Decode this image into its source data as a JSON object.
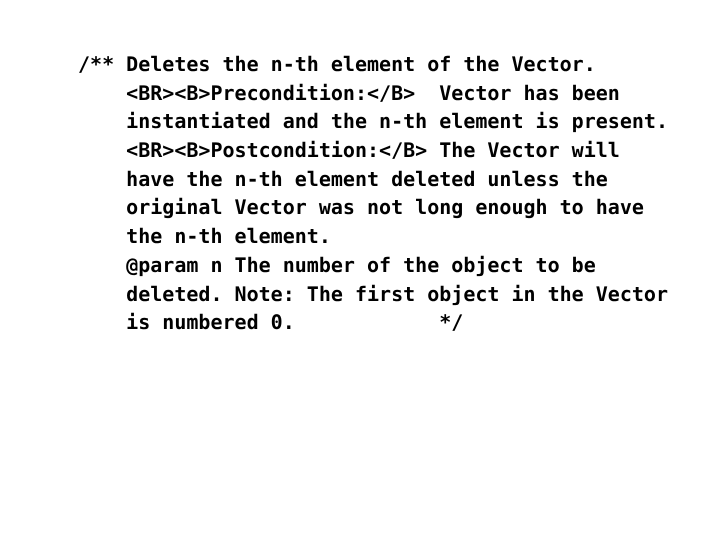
{
  "document": {
    "kind": "javadoc-comment",
    "background_color": "#ffffff",
    "text_color": "#000000",
    "lines": [
      "/** Deletes the n-th element of the Vector.",
      "    <BR><B>Precondition:</B>  Vector has been",
      "    instantiated and the n-th element is present.",
      "    <BR><B>Postcondition:</B> The Vector will",
      "    have the n-th element deleted unless the",
      "    original Vector was not long enough to have",
      "    the n-th element.",
      "    @param n The number of the object to be",
      "    deleted. Note: The first object in the Vector",
      "    is numbered 0.            */"
    ]
  }
}
